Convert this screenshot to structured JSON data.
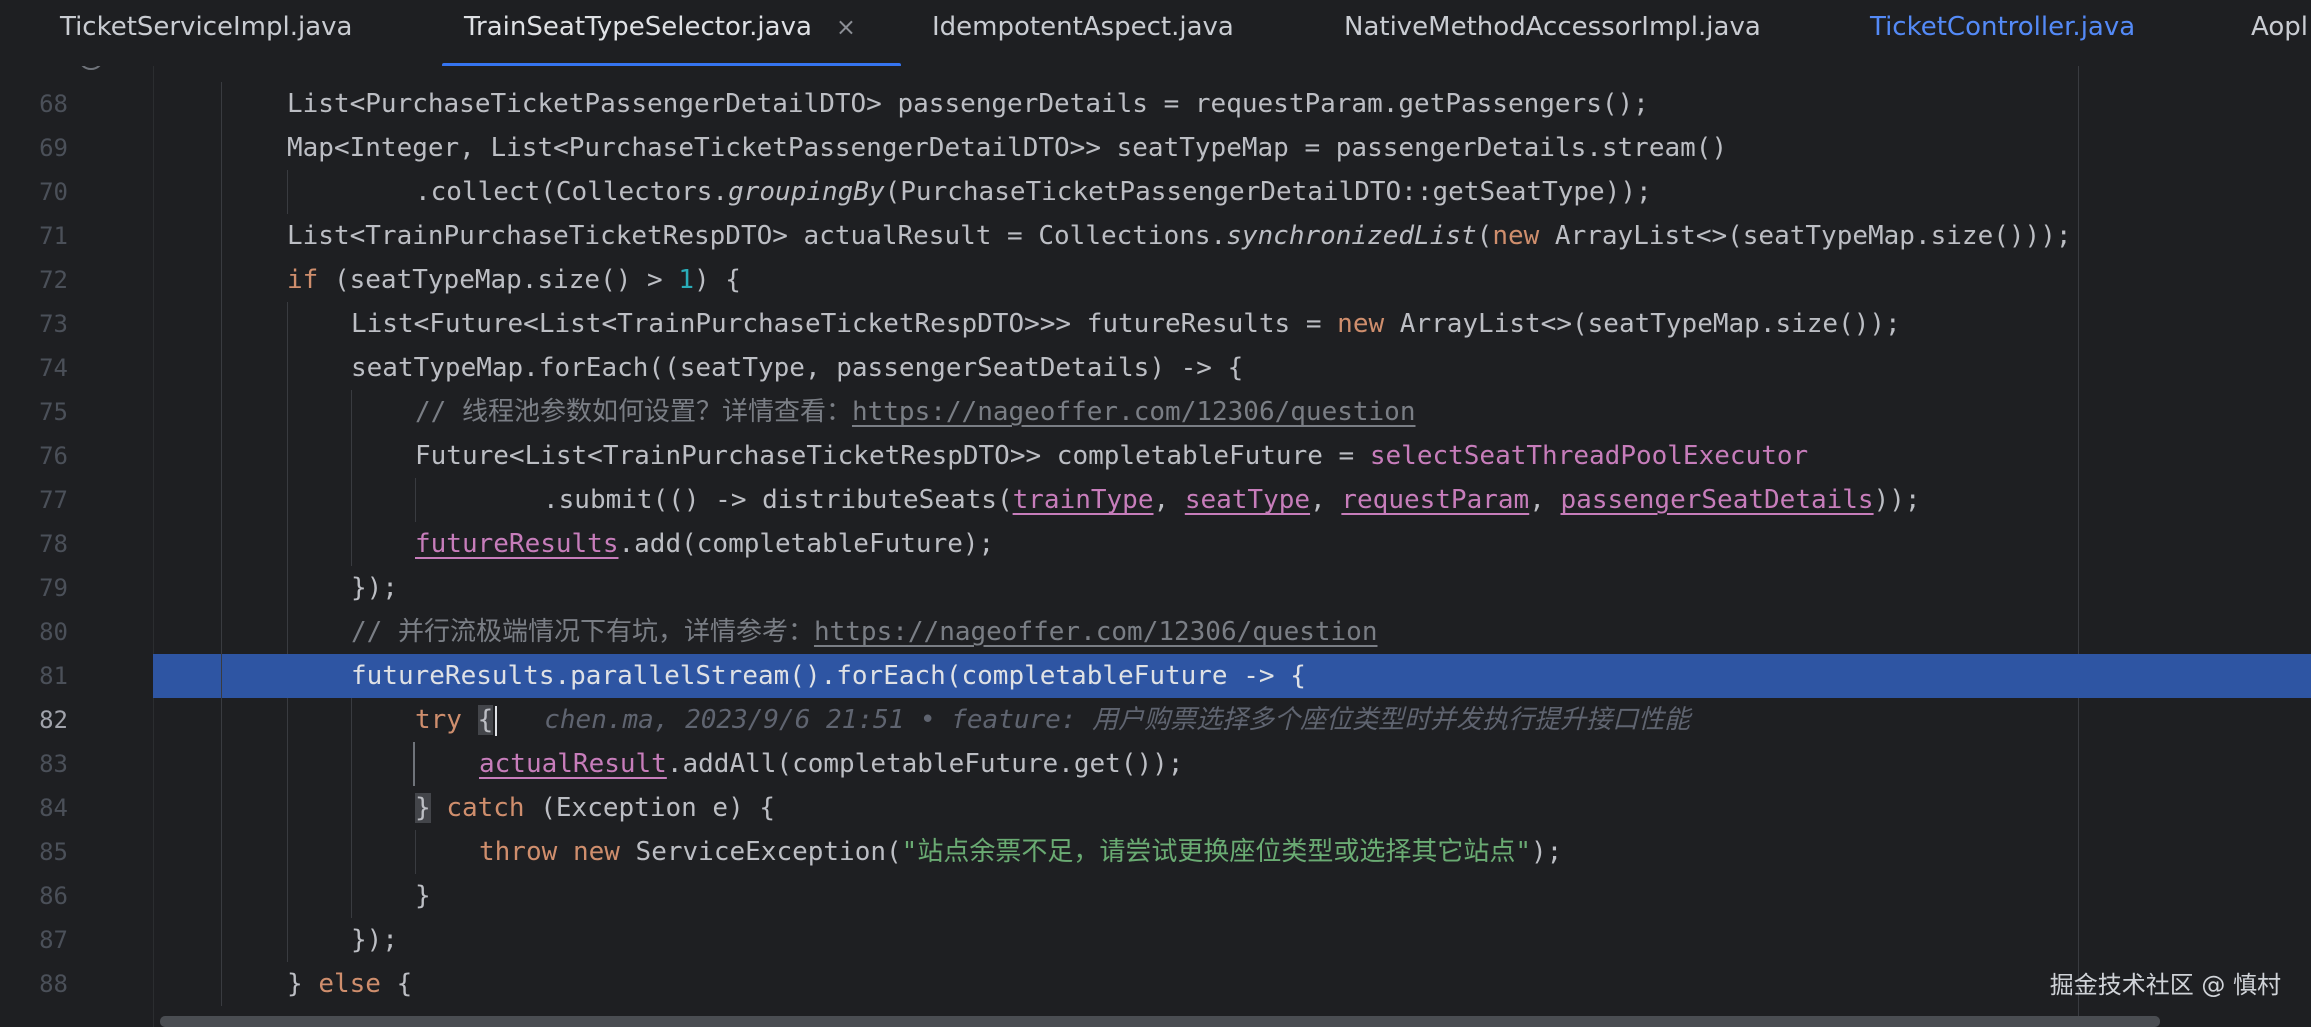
{
  "tabs": [
    {
      "label": "TicketServiceImpl.java"
    },
    {
      "label": "TrainSeatTypeSelector.java",
      "close": "×"
    },
    {
      "label": "IdempotentAspect.java"
    },
    {
      "label": "NativeMethodAccessorImpl.java"
    },
    {
      "label": "TicketController.java"
    },
    {
      "label": "Aopl"
    }
  ],
  "editor": {
    "current_line": 82,
    "highlighted_line": 81,
    "lines": [
      {
        "n": "68",
        "t0": "List<PurchaseTicketPassengerDetailDTO> passengerDetails = requestParam.getPassengers();"
      },
      {
        "n": "69",
        "t0": "Map<Integer, List<PurchaseTicketPassengerDetailDTO>> seatTypeMap = passengerDetails.stream()"
      },
      {
        "n": "70",
        "t0": ".collect(Collectors.",
        "t1": "groupingBy",
        "t2": "(PurchaseTicketPassengerDetailDTO::getSeatType));"
      },
      {
        "n": "71",
        "t0": "List<TrainPurchaseTicketRespDTO> actualResult = Collections.",
        "t1": "synchronizedList",
        "t2": "(",
        "t3": "new",
        "t4": " ArrayList<>(seatTypeMap.size()));"
      },
      {
        "n": "72",
        "t0": "if",
        "t1": " (seatTypeMap.size() > ",
        "t2": "1",
        "t3": ") {"
      },
      {
        "n": "73",
        "t0": "List<Future<List<TrainPurchaseTicketRespDTO>>> futureResults = ",
        "t1": "new",
        "t2": " ArrayList<>(seatTypeMap.size());"
      },
      {
        "n": "74",
        "t0": "seatTypeMap.forEach((seatType, passengerSeatDetails) -> {"
      },
      {
        "n": "75",
        "t0": "// 线程池参数如何设置？详情查看：",
        "t1": "https://nageoffer.com/12306/question"
      },
      {
        "n": "76",
        "t0": "Future<List<TrainPurchaseTicketRespDTO>> completableFuture = ",
        "t1": "selectSeatThreadPoolExecutor"
      },
      {
        "n": "77",
        "t0": ".submit(() -> distributeSeats(",
        "t1": "trainType",
        "t2": ", ",
        "t3": "seatType",
        "t4": ", ",
        "t5": "requestParam",
        "t6": ", ",
        "t7": "passengerSeatDetails",
        "t8": "));"
      },
      {
        "n": "78",
        "t0": "futureResults",
        "t1": ".add(completableFuture);"
      },
      {
        "n": "79",
        "t0": "});"
      },
      {
        "n": "80",
        "t0": "// 并行流极端情况下有坑，详情参考：",
        "t1": "https://nageoffer.com/12306/question"
      },
      {
        "n": "81",
        "t0": "futureResults.parallelStream().forEach(completableFuture -> {"
      },
      {
        "n": "82",
        "t0": "try",
        "t1": " ",
        "t2": "{",
        "t3": "chen.ma, 2023/9/6 21:51 • feature: 用户购票选择多个座位类型时并发执行提升接口性能"
      },
      {
        "n": "83",
        "t0": "actualResult",
        "t1": ".addAll(completableFuture.get());"
      },
      {
        "n": "84",
        "t0": "}",
        "t1": " ",
        "t2": "catch",
        "t3": " (Exception e) {"
      },
      {
        "n": "85",
        "t0": "throw",
        "t1": " ",
        "t2": "new",
        "t3": " ServiceException(",
        "t4": "\"站点余票不足，请尝试更换座位类型或选择其它站点\"",
        "t5": ");"
      },
      {
        "n": "86",
        "t0": "}"
      },
      {
        "n": "87",
        "t0": "});"
      },
      {
        "n": "88",
        "t0": "}",
        "t1": " ",
        "t2": "else",
        "t3": " {"
      }
    ]
  },
  "watermark": "掘金技术社区 @ 慎村",
  "colors": {
    "background": "#1e1f22",
    "selection": "#2e55a3",
    "keyword": "#cf8e6d",
    "field": "#c77dbb",
    "string": "#6aab73",
    "number": "#2aacb8",
    "comment": "#7a7e85",
    "tab_accent": "#3574f0"
  }
}
